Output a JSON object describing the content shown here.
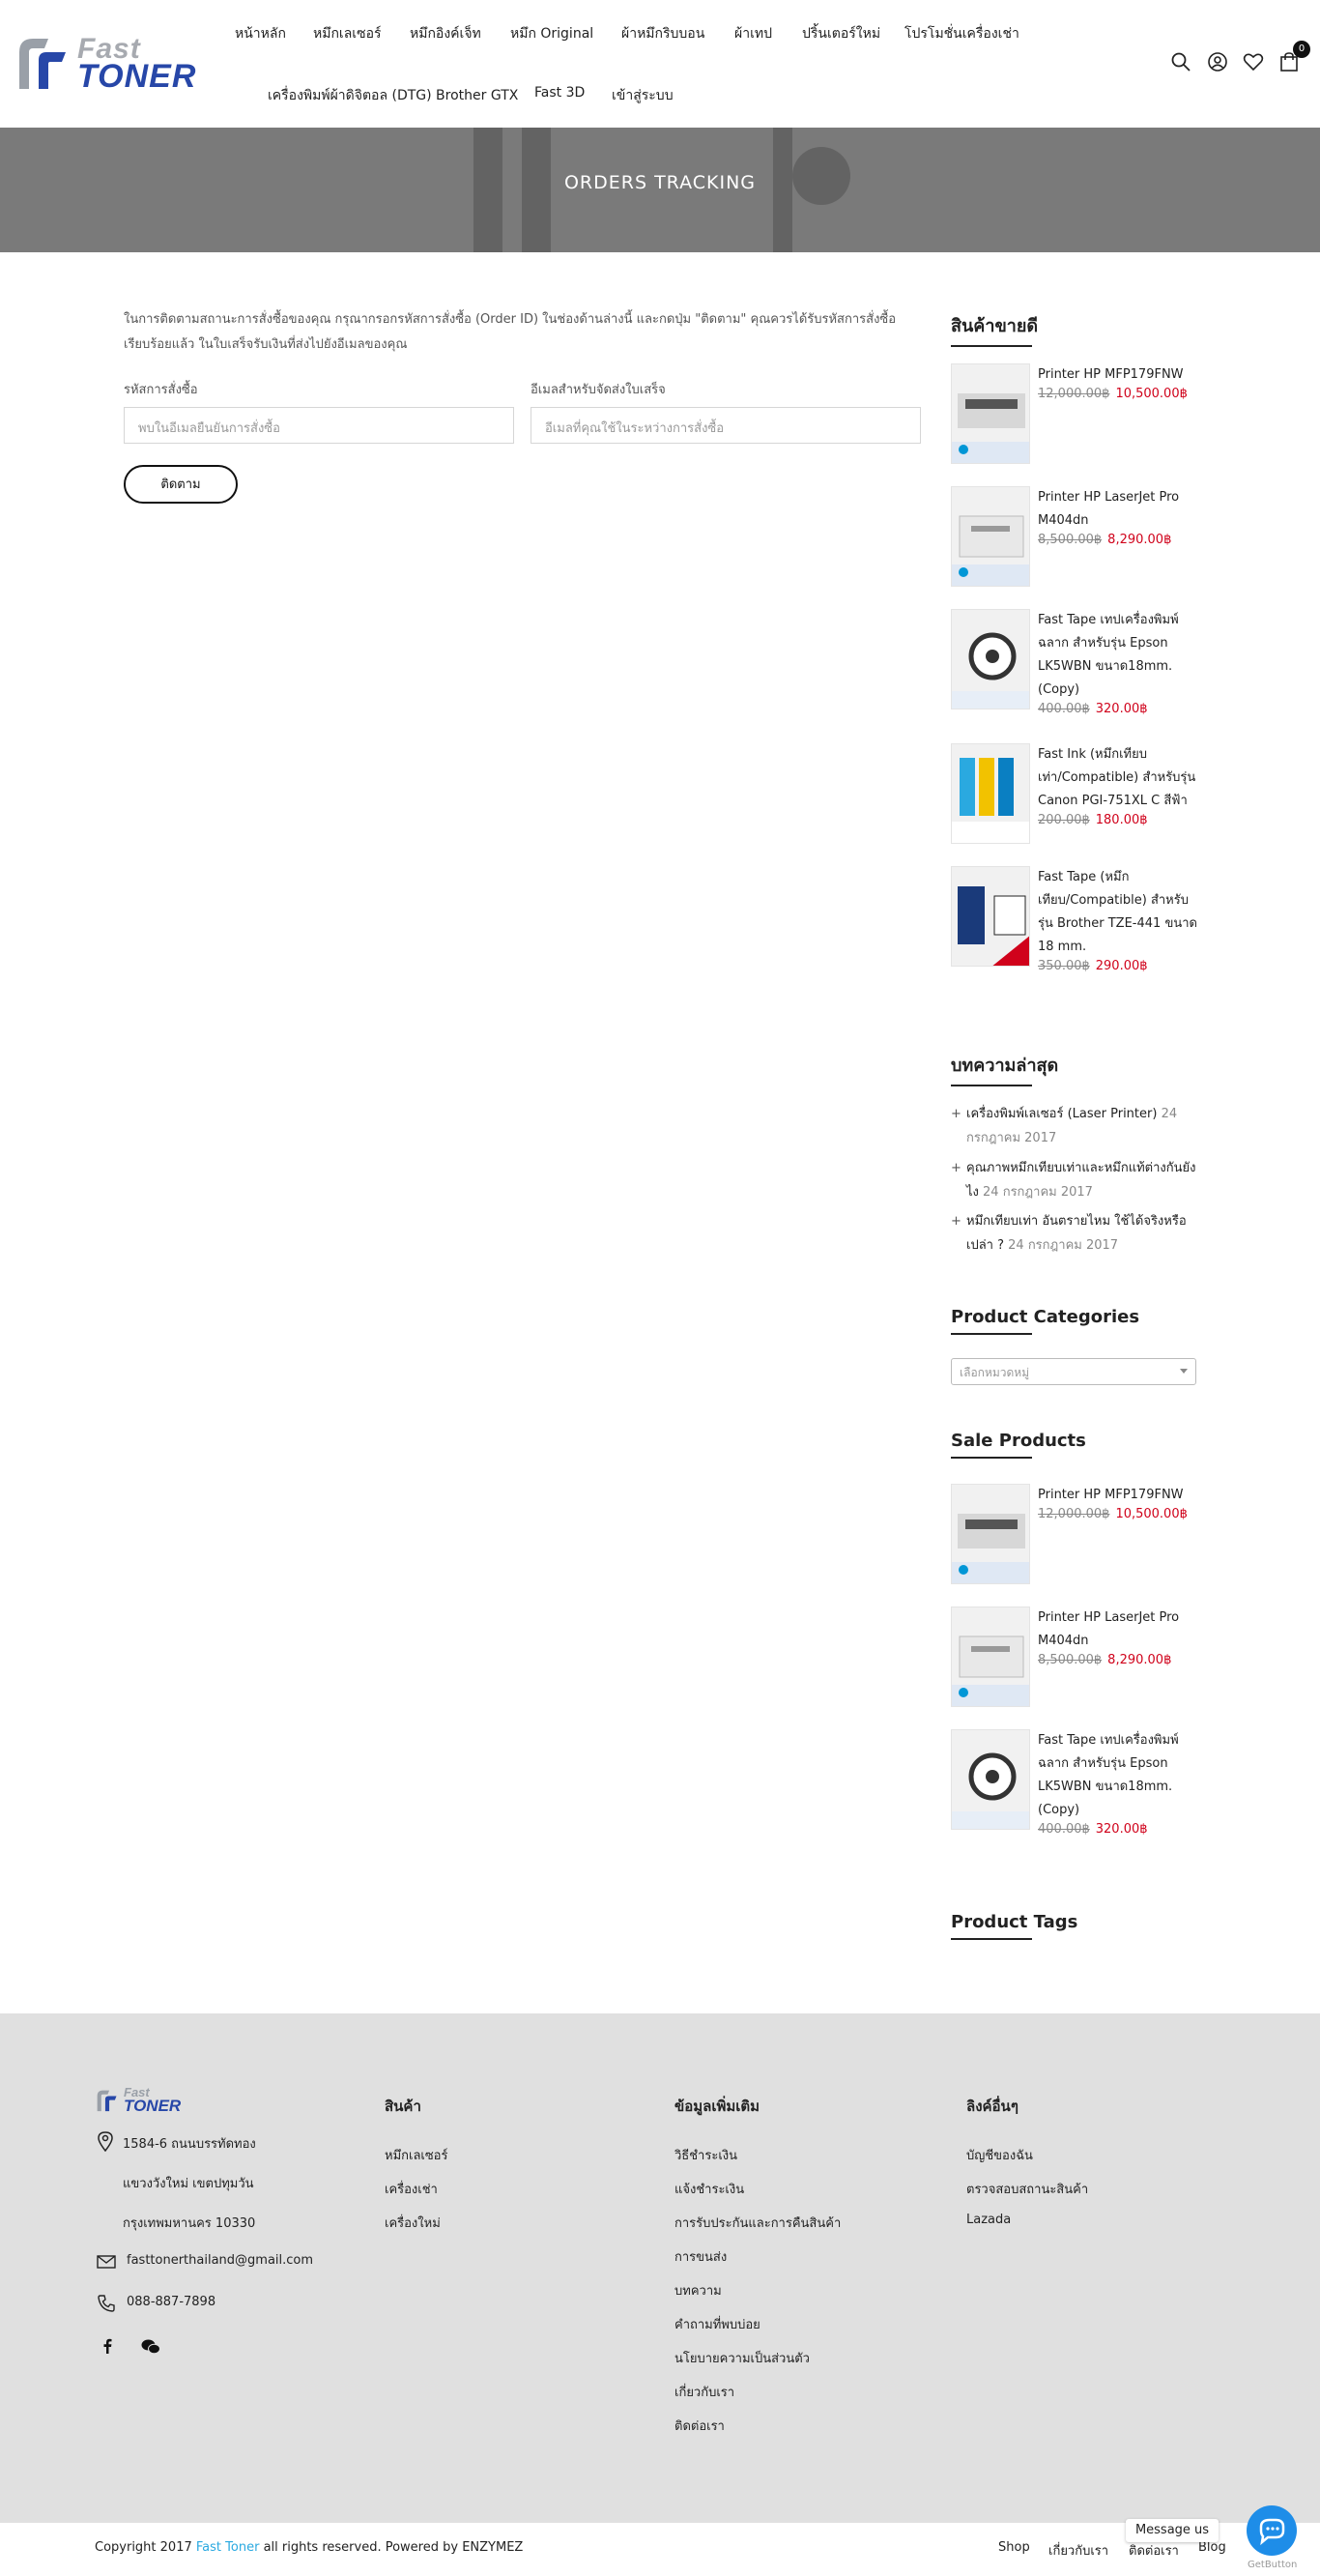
{
  "header": {
    "logo": {
      "line1": "Fast",
      "line2": "TONER"
    },
    "nav": [
      "หน้าหลัก",
      "หมึกเลเซอร์",
      "หมึกอิงค์เจ็ท",
      "หมึก Original",
      "ผ้าหมึกริบบอน",
      "ผ้าเทป",
      "ปริ้นเตอร์ใหม่",
      "โปรโมชั่นเครื่องเช่า",
      "เครื่องพิมพ์ผ้าดิจิตอล (DTG) Brother GTX",
      "Fast 3D",
      "เข้าสู่ระบบ"
    ],
    "cart_count": "0"
  },
  "banner": {
    "title": "ORDERS TRACKING"
  },
  "tracking": {
    "intro": "ในการติดตามสถานะการสั่งซื้อของคุณ กรุณากรอกรหัสการสั่งซื้อ (Order ID) ในช่องด้านล่างนี้ และกดปุ่ม \"ติดตาม\" คุณควรได้รับรหัสการสั่งซื้อเรียบร้อยแล้ว ในใบเสร็จรับเงินที่ส่งไปยังอีเมลของคุณ",
    "order_label": "รหัสการสั่งซื้อ",
    "order_placeholder": "พบในอีเมลยืนยันการสั่งซื้อ",
    "email_label": "อีเมลสำหรับจัดส่งใบเสร็จ",
    "email_placeholder": "อีเมลที่คุณใช้ในระหว่างการสั่งซื้อ",
    "button": "ติดตาม"
  },
  "sidebar": {
    "bestseller_title": "สินค้าขายดี",
    "bestsellers": [
      {
        "name": "Printer HP MFP179FNW",
        "old": "12,000.00฿",
        "new": "10,500.00฿"
      },
      {
        "name": "Printer HP LaserJet Pro M404dn",
        "old": "8,500.00฿",
        "new": "8,290.00฿"
      },
      {
        "name": "Fast Tape เทปเครื่องพิมพ์ฉลาก สำหรับรุ่น Epson LK5WBN ขนาด18mm. (Copy)",
        "old": "400.00฿",
        "new": "320.00฿"
      },
      {
        "name": "Fast Ink (หมึกเทียบเท่า/Compatible) สำหรับรุ่น Canon PGI-751XL C สีฟ้า",
        "old": "200.00฿",
        "new": "180.00฿"
      },
      {
        "name": "Fast Tape (หมึกเทียบ/Compatible) สำหรับรุ่น Brother TZE-441 ขนาด 18 mm.",
        "old": "350.00฿",
        "new": "290.00฿"
      }
    ],
    "recent_title": "บทความล่าสุด",
    "recent": [
      {
        "title": "เครื่องพิมพ์เลเซอร์ (Laser Printer)",
        "date": "24 กรกฎาคม 2017"
      },
      {
        "title": "คุณภาพหมึกเทียบเท่าและหมึกแท้ต่างกันยังไง",
        "date": "24 กรกฎาคม 2017"
      },
      {
        "title": "หมึกเทียบเท่า อันตรายไหม ใช้ได้จริงหรือเปล่า ?",
        "date": "24 กรกฎาคม 2017"
      }
    ],
    "categories_title": "Product Categories",
    "categories_placeholder": "เลือกหมวดหมู่",
    "sale_title": "Sale Products",
    "sale": [
      {
        "name": "Printer HP MFP179FNW",
        "old": "12,000.00฿",
        "new": "10,500.00฿"
      },
      {
        "name": "Printer HP LaserJet Pro M404dn",
        "old": "8,500.00฿",
        "new": "8,290.00฿"
      },
      {
        "name": "Fast Tape เทปเครื่องพิมพ์ฉลาก สำหรับรุ่น Epson LK5WBN ขนาด18mm. (Copy)",
        "old": "400.00฿",
        "new": "320.00฿"
      }
    ],
    "tags_title": "Product Tags"
  },
  "footer": {
    "logo": {
      "line1": "Fast",
      "line2": "TONER"
    },
    "address": [
      "1584-6 ถนนบรรทัดทอง",
      "แขวงวังใหม่ เขตปทุมวัน",
      "กรุงเทพมหานคร 10330"
    ],
    "email": "fasttonerthailand@gmail.com",
    "phone": "088-887-7898",
    "col2_title": "สินค้า",
    "col2": [
      "หมึกเลเซอร์",
      "เครื่องเช่า",
      "เครื่องใหม่"
    ],
    "col3_title": "ข้อมูลเพิ่มเติม",
    "col3": [
      "วิธีชำระเงิน",
      "แจ้งชำระเงิน",
      "การรับประกันและการคืนสินค้า",
      "การขนส่ง",
      "บทความ",
      "คำถามที่พบบ่อย",
      "นโยบายความเป็นส่วนตัว",
      "เกี่ยวกับเรา",
      "ติดต่อเรา"
    ],
    "col4_title": "ลิงค์อื่นๆ",
    "col4": [
      "บัญชีของฉัน",
      "ตรวจสอบสถานะสินค้า",
      "Lazada"
    ],
    "copyright_pre": "Copyright 2017",
    "copyright_brand": "Fast Toner",
    "copyright_post": "all rights reserved. Powered by ENZYMEZ",
    "bottom_links": [
      "Shop",
      "เกี่ยวกับเรา",
      "ติดต่อเรา",
      "Blog"
    ],
    "message_us": "Message us",
    "getbutton": "GetButton"
  },
  "colors": {
    "accent": "#2aa9e0",
    "sale": "#d0021b",
    "brand_blue": "#2747a8",
    "banner": "#7a7a7a",
    "footer_bg": "#e0e0e0"
  }
}
